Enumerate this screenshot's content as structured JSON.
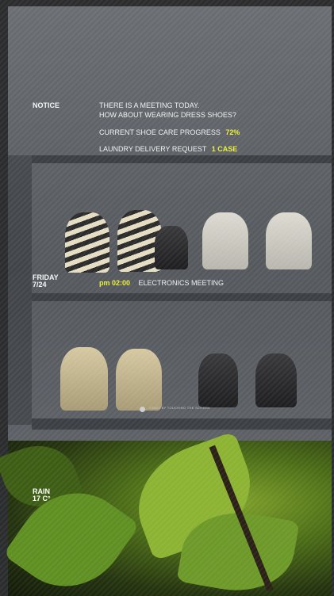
{
  "notice": {
    "label": "NOTICE",
    "message_line1": "THERE IS A MEETING TODAY.",
    "message_line2": "HOW ABOUT WEARING DRESS SHOES?",
    "progress_label": "CURRENT SHOE CARE PROGRESS",
    "progress_value": "72%",
    "laundry_label": "LAUNDRY DELIVERY REQUEST",
    "laundry_value": "1 CASE"
  },
  "schedule": {
    "day": "FRIDAY",
    "date": "7/24",
    "time": "pm 02:00",
    "event": "ELECTRONICS MEETING"
  },
  "hint": {
    "text": "START BY TOUCHING THE SCREEN",
    "icon": "touch-icon"
  },
  "weather": {
    "condition": "RAIN",
    "temperature": "17 C°"
  },
  "colors": {
    "accent": "#eaf03a",
    "text": "#f2f2f2"
  }
}
